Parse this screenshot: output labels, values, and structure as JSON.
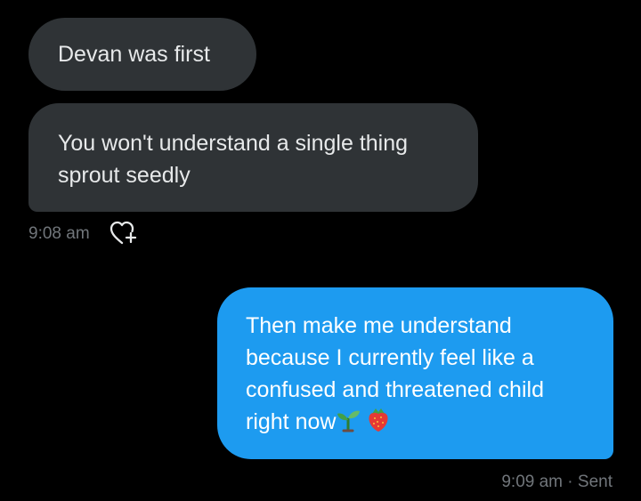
{
  "messages": [
    {
      "direction": "incoming",
      "lines": [
        "Devan was first"
      ]
    },
    {
      "direction": "incoming",
      "lines": [
        "You won't understand a single thing",
        "sprout seedly"
      ]
    },
    {
      "direction": "outgoing",
      "lines": [
        "Then make me understand",
        "because I currently feel like a",
        "confused and threatened child",
        "right now"
      ]
    }
  ],
  "incoming_time": "9:08 am",
  "outgoing_time": "9:09 am",
  "outgoing_separator": " · ",
  "outgoing_status": "Sent",
  "icons": {
    "react": "heart-plus-icon",
    "seedling": "seedling-icon",
    "strawberry": "strawberry-icon"
  },
  "colors": {
    "background": "#000000",
    "incoming_bubble": "#2f3336",
    "outgoing_bubble": "#1d9bf0",
    "meta_text": "#71767b"
  }
}
